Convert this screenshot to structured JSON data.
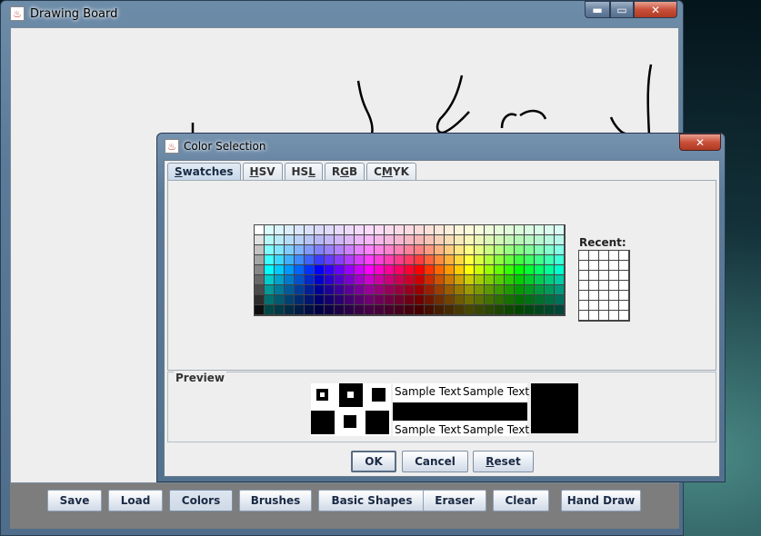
{
  "main_window": {
    "title": "Drawing Board",
    "controls": {
      "minimize": "▬",
      "maximize": "▭",
      "close": "✕"
    }
  },
  "toolbar": {
    "buttons": [
      {
        "label": "Save"
      },
      {
        "label": "Load"
      },
      {
        "label": "Colors",
        "active": true
      },
      {
        "label": "Brushes"
      },
      {
        "label": "Basic Shapes"
      },
      {
        "label": "Eraser"
      },
      {
        "label": "Clear"
      },
      {
        "label": "Hand Draw"
      }
    ]
  },
  "dialog": {
    "title": "Color Selection",
    "close": "✕",
    "tabs": [
      {
        "pre": "",
        "key": "S",
        "post": "watches",
        "active": true
      },
      {
        "pre": "",
        "key": "H",
        "post": "SV"
      },
      {
        "pre": "HS",
        "key": "L",
        "post": ""
      },
      {
        "pre": "R",
        "key": "G",
        "post": "B"
      },
      {
        "pre": "C",
        "key": "M",
        "post": "YK"
      }
    ],
    "recent_label": "Recent:",
    "preview_label": "Preview",
    "sample_text": "Sample Text",
    "buttons": {
      "ok": "OK",
      "cancel": "Cancel",
      "reset_key": "R",
      "reset_rest": "eset"
    }
  },
  "colors": {
    "selected": "#000000"
  }
}
